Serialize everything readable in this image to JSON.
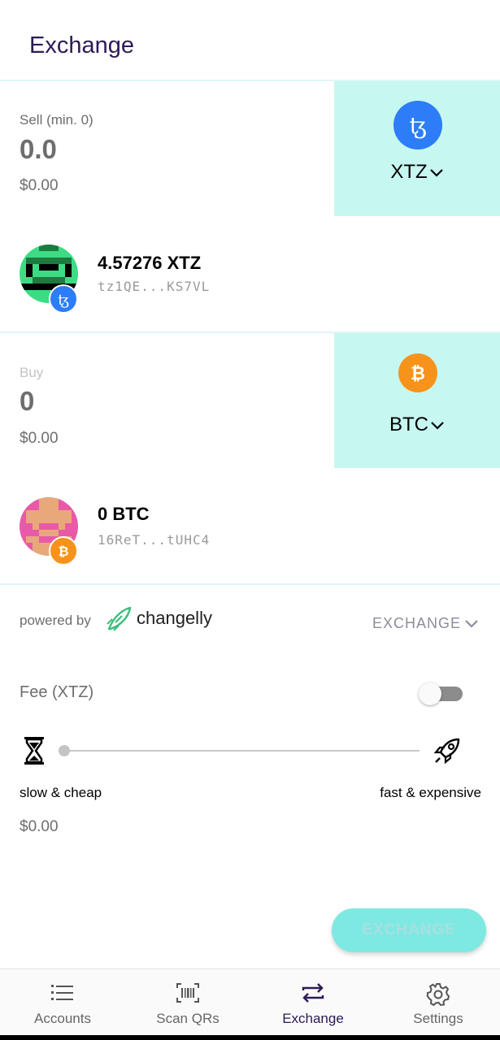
{
  "header": {
    "title": "Exchange"
  },
  "sell": {
    "label": "Sell (min. 0)",
    "amount": "0.0",
    "fiat": "$0.00",
    "coin_symbol": "XTZ",
    "coin_color": "#2c7df7",
    "wallet": {
      "balance": "4.57276 XTZ",
      "address": "tz1QE...KS7VL"
    }
  },
  "buy": {
    "label": "Buy",
    "amount": "0",
    "fiat": "$0.00",
    "coin_symbol": "BTC",
    "coin_color": "#f7931a",
    "wallet": {
      "balance": "0 BTC",
      "address": "16ReT...tUHC4"
    }
  },
  "provider": {
    "powered_by": "powered by",
    "name": "changelly",
    "selected": "EXCHANGE"
  },
  "fee": {
    "label": "Fee (XTZ)",
    "toggle_on": false,
    "slider_level": 0,
    "slow_label": "slow & cheap",
    "fast_label": "fast & expensive",
    "fiat": "$0.00"
  },
  "actions": {
    "exchange_label": "EXCHANGE"
  },
  "nav": {
    "items": [
      {
        "label": "Accounts",
        "icon": "list-icon"
      },
      {
        "label": "Scan QRs",
        "icon": "barcode-icon"
      },
      {
        "label": "Exchange",
        "icon": "swap-icon",
        "active": true
      },
      {
        "label": "Settings",
        "icon": "gear-icon"
      }
    ]
  },
  "colors": {
    "accent": "#c6f7f1",
    "title": "#2d1a57",
    "button": "#7ee9e2"
  }
}
